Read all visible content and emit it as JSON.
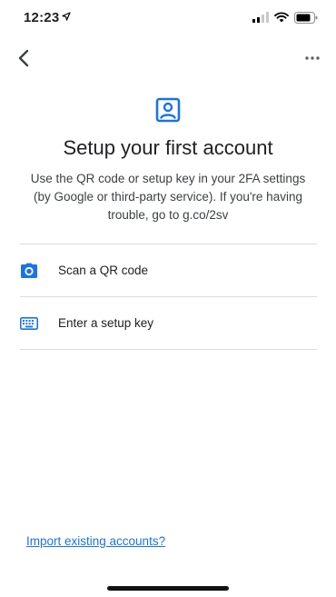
{
  "status_bar": {
    "time": "12:23"
  },
  "header": {
    "title": "Setup your first account",
    "description": "Use the QR code or setup key in your 2FA settings (by Google or third-party service). If you're having trouble, go to g.co/2sv"
  },
  "options": [
    {
      "label": "Scan a QR code",
      "icon": "camera-icon"
    },
    {
      "label": "Enter a setup key",
      "icon": "keyboard-icon"
    }
  ],
  "footer": {
    "import_link": "Import existing accounts?"
  },
  "colors": {
    "accent": "#1a73e8",
    "text": "#202124",
    "divider": "#dadce0"
  }
}
